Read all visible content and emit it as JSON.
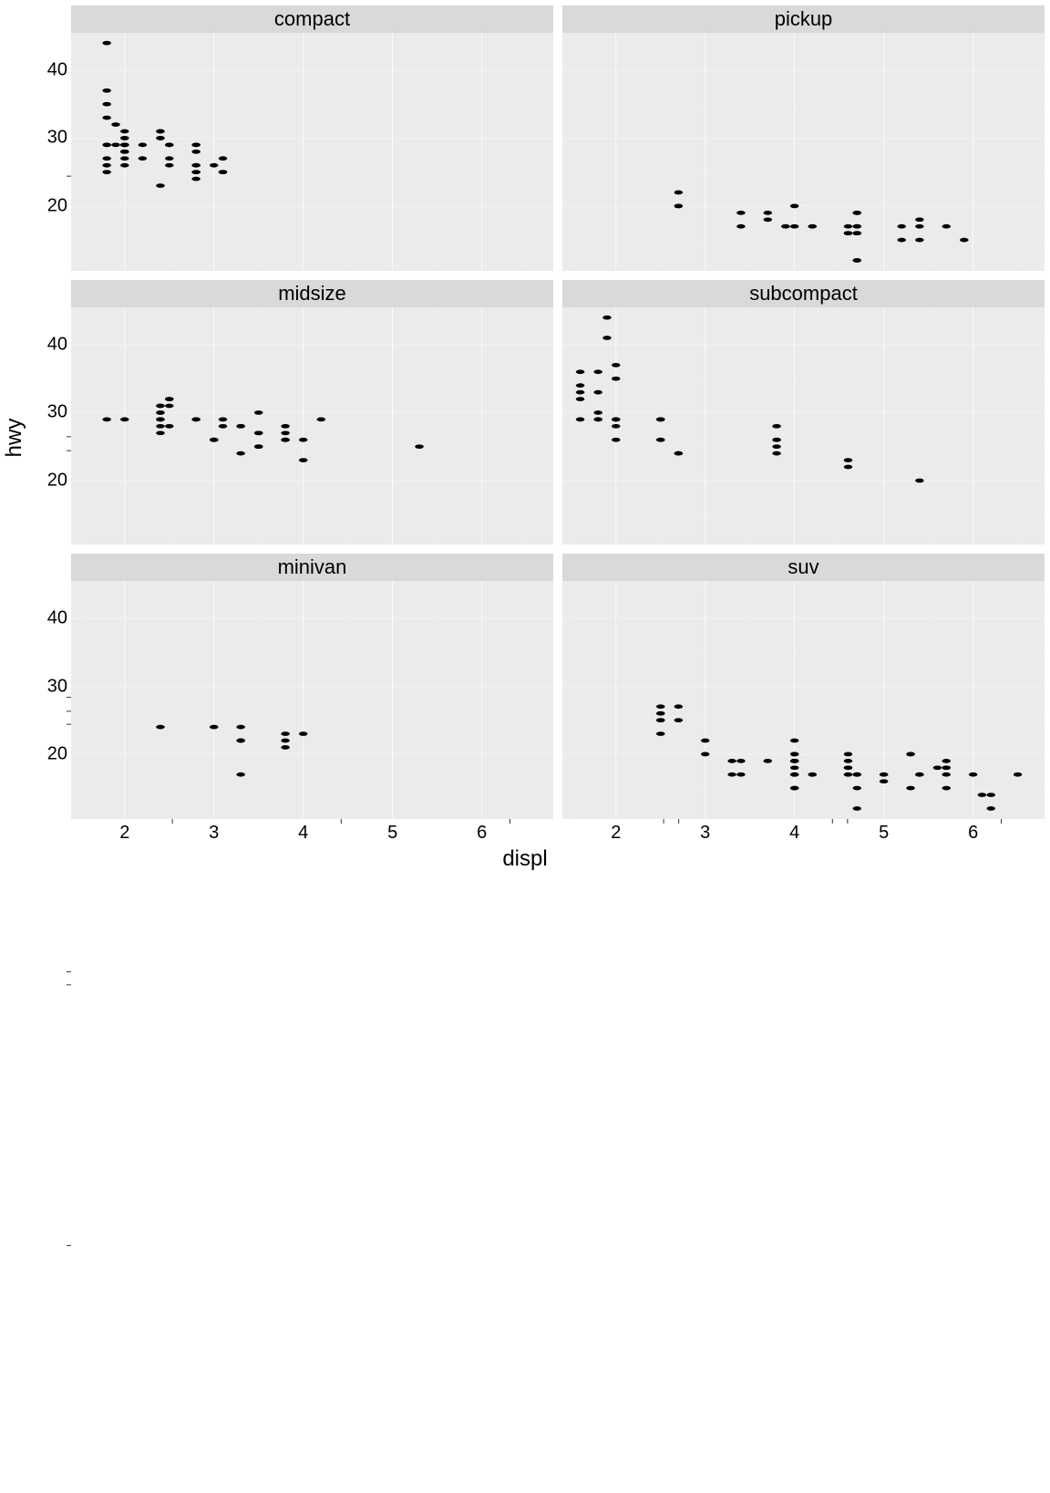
{
  "chart_data": {
    "type": "scatter",
    "xlabel": "displ",
    "ylabel": "hwy",
    "xlim": [
      1.4,
      6.8
    ],
    "ylim": [
      10.5,
      45.5
    ],
    "x_breaks": [
      2,
      3,
      4,
      5,
      6
    ],
    "y_breaks": [
      20,
      30,
      40
    ],
    "x_minor": [
      1.5,
      2.5,
      3.5,
      4.5,
      5.5,
      6.5
    ],
    "y_minor": [
      15,
      25,
      35,
      45
    ],
    "facets": [
      {
        "name": "compact",
        "points": [
          [
            1.8,
            29
          ],
          [
            1.8,
            29
          ],
          [
            2.0,
            31
          ],
          [
            2.0,
            30
          ],
          [
            2.8,
            26
          ],
          [
            2.8,
            26
          ],
          [
            3.1,
            27
          ],
          [
            1.8,
            26
          ],
          [
            1.8,
            25
          ],
          [
            2.0,
            28
          ],
          [
            2.0,
            27
          ],
          [
            2.8,
            25
          ],
          [
            2.8,
            25
          ],
          [
            3.1,
            25
          ],
          [
            3.1,
            25
          ],
          [
            2.4,
            30
          ],
          [
            2.4,
            30
          ],
          [
            2.5,
            26
          ],
          [
            2.5,
            27
          ],
          [
            2.2,
            27
          ],
          [
            2.2,
            29
          ],
          [
            2.4,
            31
          ],
          [
            2.4,
            31
          ],
          [
            3.0,
            26
          ],
          [
            1.8,
            35
          ],
          [
            1.8,
            37
          ],
          [
            1.8,
            44
          ],
          [
            2.0,
            29
          ],
          [
            2.0,
            26
          ],
          [
            2.0,
            29
          ],
          [
            2.0,
            29
          ],
          [
            2.8,
            24
          ],
          [
            2.8,
            29
          ],
          [
            1.9,
            29
          ],
          [
            1.9,
            32
          ],
          [
            2.0,
            28
          ],
          [
            2.0,
            30
          ],
          [
            2.5,
            29
          ],
          [
            2.5,
            29
          ],
          [
            2.8,
            29
          ],
          [
            2.0,
            29
          ],
          [
            2.0,
            28
          ],
          [
            2.0,
            29
          ],
          [
            2.8,
            28
          ],
          [
            1.8,
            33
          ],
          [
            1.8,
            27
          ],
          [
            2.4,
            23
          ]
        ]
      },
      {
        "name": "midsize",
        "points": [
          [
            2.8,
            29
          ],
          [
            3.1,
            29
          ],
          [
            3.1,
            28
          ],
          [
            4.2,
            29
          ],
          [
            3.5,
            25
          ],
          [
            3.5,
            25
          ],
          [
            3.8,
            26
          ],
          [
            3.8,
            26
          ],
          [
            3.8,
            27
          ],
          [
            5.3,
            25
          ],
          [
            2.4,
            29
          ],
          [
            2.4,
            29
          ],
          [
            2.4,
            29
          ],
          [
            3.3,
            24
          ],
          [
            2.4,
            27
          ],
          [
            2.4,
            28
          ],
          [
            2.4,
            30
          ],
          [
            2.4,
            30
          ],
          [
            2.5,
            32
          ],
          [
            2.5,
            28
          ],
          [
            3.5,
            30
          ],
          [
            3.5,
            27
          ],
          [
            3.0,
            26
          ],
          [
            3.0,
            26
          ],
          [
            3.5,
            27
          ],
          [
            3.3,
            28
          ],
          [
            3.3,
            28
          ],
          [
            4.0,
            26
          ],
          [
            3.8,
            28
          ],
          [
            3.8,
            26
          ],
          [
            3.8,
            26
          ],
          [
            4.0,
            23
          ],
          [
            2.4,
            31
          ],
          [
            2.4,
            31
          ],
          [
            2.5,
            31
          ],
          [
            2.5,
            32
          ],
          [
            3.5,
            27
          ],
          [
            3.5,
            25
          ],
          [
            3.0,
            26
          ],
          [
            3.0,
            26
          ],
          [
            2.0,
            29
          ],
          [
            2.8,
            29
          ],
          [
            1.8,
            29
          ]
        ]
      },
      {
        "name": "minivan",
        "points": [
          [
            2.4,
            24
          ],
          [
            3.0,
            24
          ],
          [
            3.3,
            22
          ],
          [
            3.3,
            22
          ],
          [
            3.3,
            22
          ],
          [
            3.3,
            17
          ],
          [
            3.3,
            24
          ],
          [
            3.8,
            22
          ],
          [
            3.8,
            21
          ],
          [
            3.8,
            23
          ],
          [
            4.0,
            23
          ]
        ]
      },
      {
        "name": "pickup",
        "points": [
          [
            3.7,
            19
          ],
          [
            3.7,
            18
          ],
          [
            3.9,
            17
          ],
          [
            3.9,
            17
          ],
          [
            4.7,
            19
          ],
          [
            4.7,
            19
          ],
          [
            4.7,
            12
          ],
          [
            5.2,
            17
          ],
          [
            5.2,
            15
          ],
          [
            5.7,
            17
          ],
          [
            5.9,
            15
          ],
          [
            4.7,
            12
          ],
          [
            4.7,
            17
          ],
          [
            4.7,
            16
          ],
          [
            4.7,
            17
          ],
          [
            4.7,
            17
          ],
          [
            4.7,
            16
          ],
          [
            4.7,
            16
          ],
          [
            4.2,
            17
          ],
          [
            4.2,
            17
          ],
          [
            4.6,
            16
          ],
          [
            4.6,
            16
          ],
          [
            4.6,
            17
          ],
          [
            5.4,
            17
          ],
          [
            5.4,
            15
          ],
          [
            5.4,
            18
          ],
          [
            2.7,
            22
          ],
          [
            2.7,
            20
          ],
          [
            2.7,
            20
          ],
          [
            3.4,
            17
          ],
          [
            3.4,
            19
          ],
          [
            4.0,
            20
          ],
          [
            4.0,
            17
          ]
        ]
      },
      {
        "name": "subcompact",
        "points": [
          [
            3.8,
            26
          ],
          [
            3.8,
            25
          ],
          [
            3.8,
            26
          ],
          [
            3.8,
            24
          ],
          [
            3.8,
            28
          ],
          [
            4.6,
            23
          ],
          [
            4.6,
            22
          ],
          [
            5.4,
            20
          ],
          [
            1.6,
            33
          ],
          [
            1.6,
            32
          ],
          [
            1.6,
            29
          ],
          [
            1.6,
            36
          ],
          [
            1.6,
            34
          ],
          [
            1.8,
            36
          ],
          [
            1.8,
            30
          ],
          [
            1.8,
            33
          ],
          [
            2.0,
            35
          ],
          [
            2.0,
            37
          ],
          [
            2.5,
            29
          ],
          [
            2.5,
            29
          ],
          [
            2.5,
            26
          ],
          [
            2.5,
            26
          ],
          [
            2.7,
            24
          ],
          [
            2.7,
            24
          ],
          [
            1.9,
            44
          ],
          [
            2.0,
            29
          ],
          [
            2.0,
            29
          ],
          [
            2.5,
            29
          ],
          [
            2.5,
            29
          ],
          [
            1.8,
            29
          ],
          [
            1.8,
            29
          ],
          [
            2.0,
            28
          ],
          [
            2.0,
            29
          ],
          [
            1.9,
            41
          ],
          [
            2.0,
            26
          ]
        ]
      },
      {
        "name": "suv",
        "points": [
          [
            5.3,
            20
          ],
          [
            5.3,
            15
          ],
          [
            5.3,
            20
          ],
          [
            5.7,
            19
          ],
          [
            6.0,
            17
          ],
          [
            5.7,
            15
          ],
          [
            5.7,
            17
          ],
          [
            6.2,
            12
          ],
          [
            6.2,
            14
          ],
          [
            6.5,
            17
          ],
          [
            2.5,
            26
          ],
          [
            2.5,
            23
          ],
          [
            2.5,
            26
          ],
          [
            2.5,
            25
          ],
          [
            2.5,
            27
          ],
          [
            2.5,
            25
          ],
          [
            3.0,
            20
          ],
          [
            2.7,
            27
          ],
          [
            2.7,
            25
          ],
          [
            3.4,
            19
          ],
          [
            3.4,
            17
          ],
          [
            4.0,
            19
          ],
          [
            4.0,
            19
          ],
          [
            4.0,
            17
          ],
          [
            4.0,
            22
          ],
          [
            4.7,
            17
          ],
          [
            4.7,
            15
          ],
          [
            4.7,
            17
          ],
          [
            5.7,
            18
          ],
          [
            4.0,
            17
          ],
          [
            4.0,
            17
          ],
          [
            4.0,
            19
          ],
          [
            4.0,
            19
          ],
          [
            4.6,
            19
          ],
          [
            5.0,
            17
          ],
          [
            4.2,
            17
          ],
          [
            4.2,
            17
          ],
          [
            4.6,
            18
          ],
          [
            4.6,
            18
          ],
          [
            4.6,
            17
          ],
          [
            4.6,
            17
          ],
          [
            5.0,
            16
          ],
          [
            5.4,
            17
          ],
          [
            5.4,
            17
          ],
          [
            5.4,
            17
          ],
          [
            4.0,
            15
          ],
          [
            4.0,
            20
          ],
          [
            4.6,
            20
          ],
          [
            5.0,
            17
          ],
          [
            3.3,
            17
          ],
          [
            3.3,
            19
          ],
          [
            4.0,
            15
          ],
          [
            5.6,
            18
          ],
          [
            3.0,
            22
          ],
          [
            3.7,
            19
          ],
          [
            4.0,
            18
          ],
          [
            4.7,
            17
          ],
          [
            4.7,
            12
          ],
          [
            4.7,
            17
          ],
          [
            5.7,
            18
          ],
          [
            6.1,
            14
          ],
          [
            4.0,
            20
          ]
        ]
      }
    ]
  }
}
